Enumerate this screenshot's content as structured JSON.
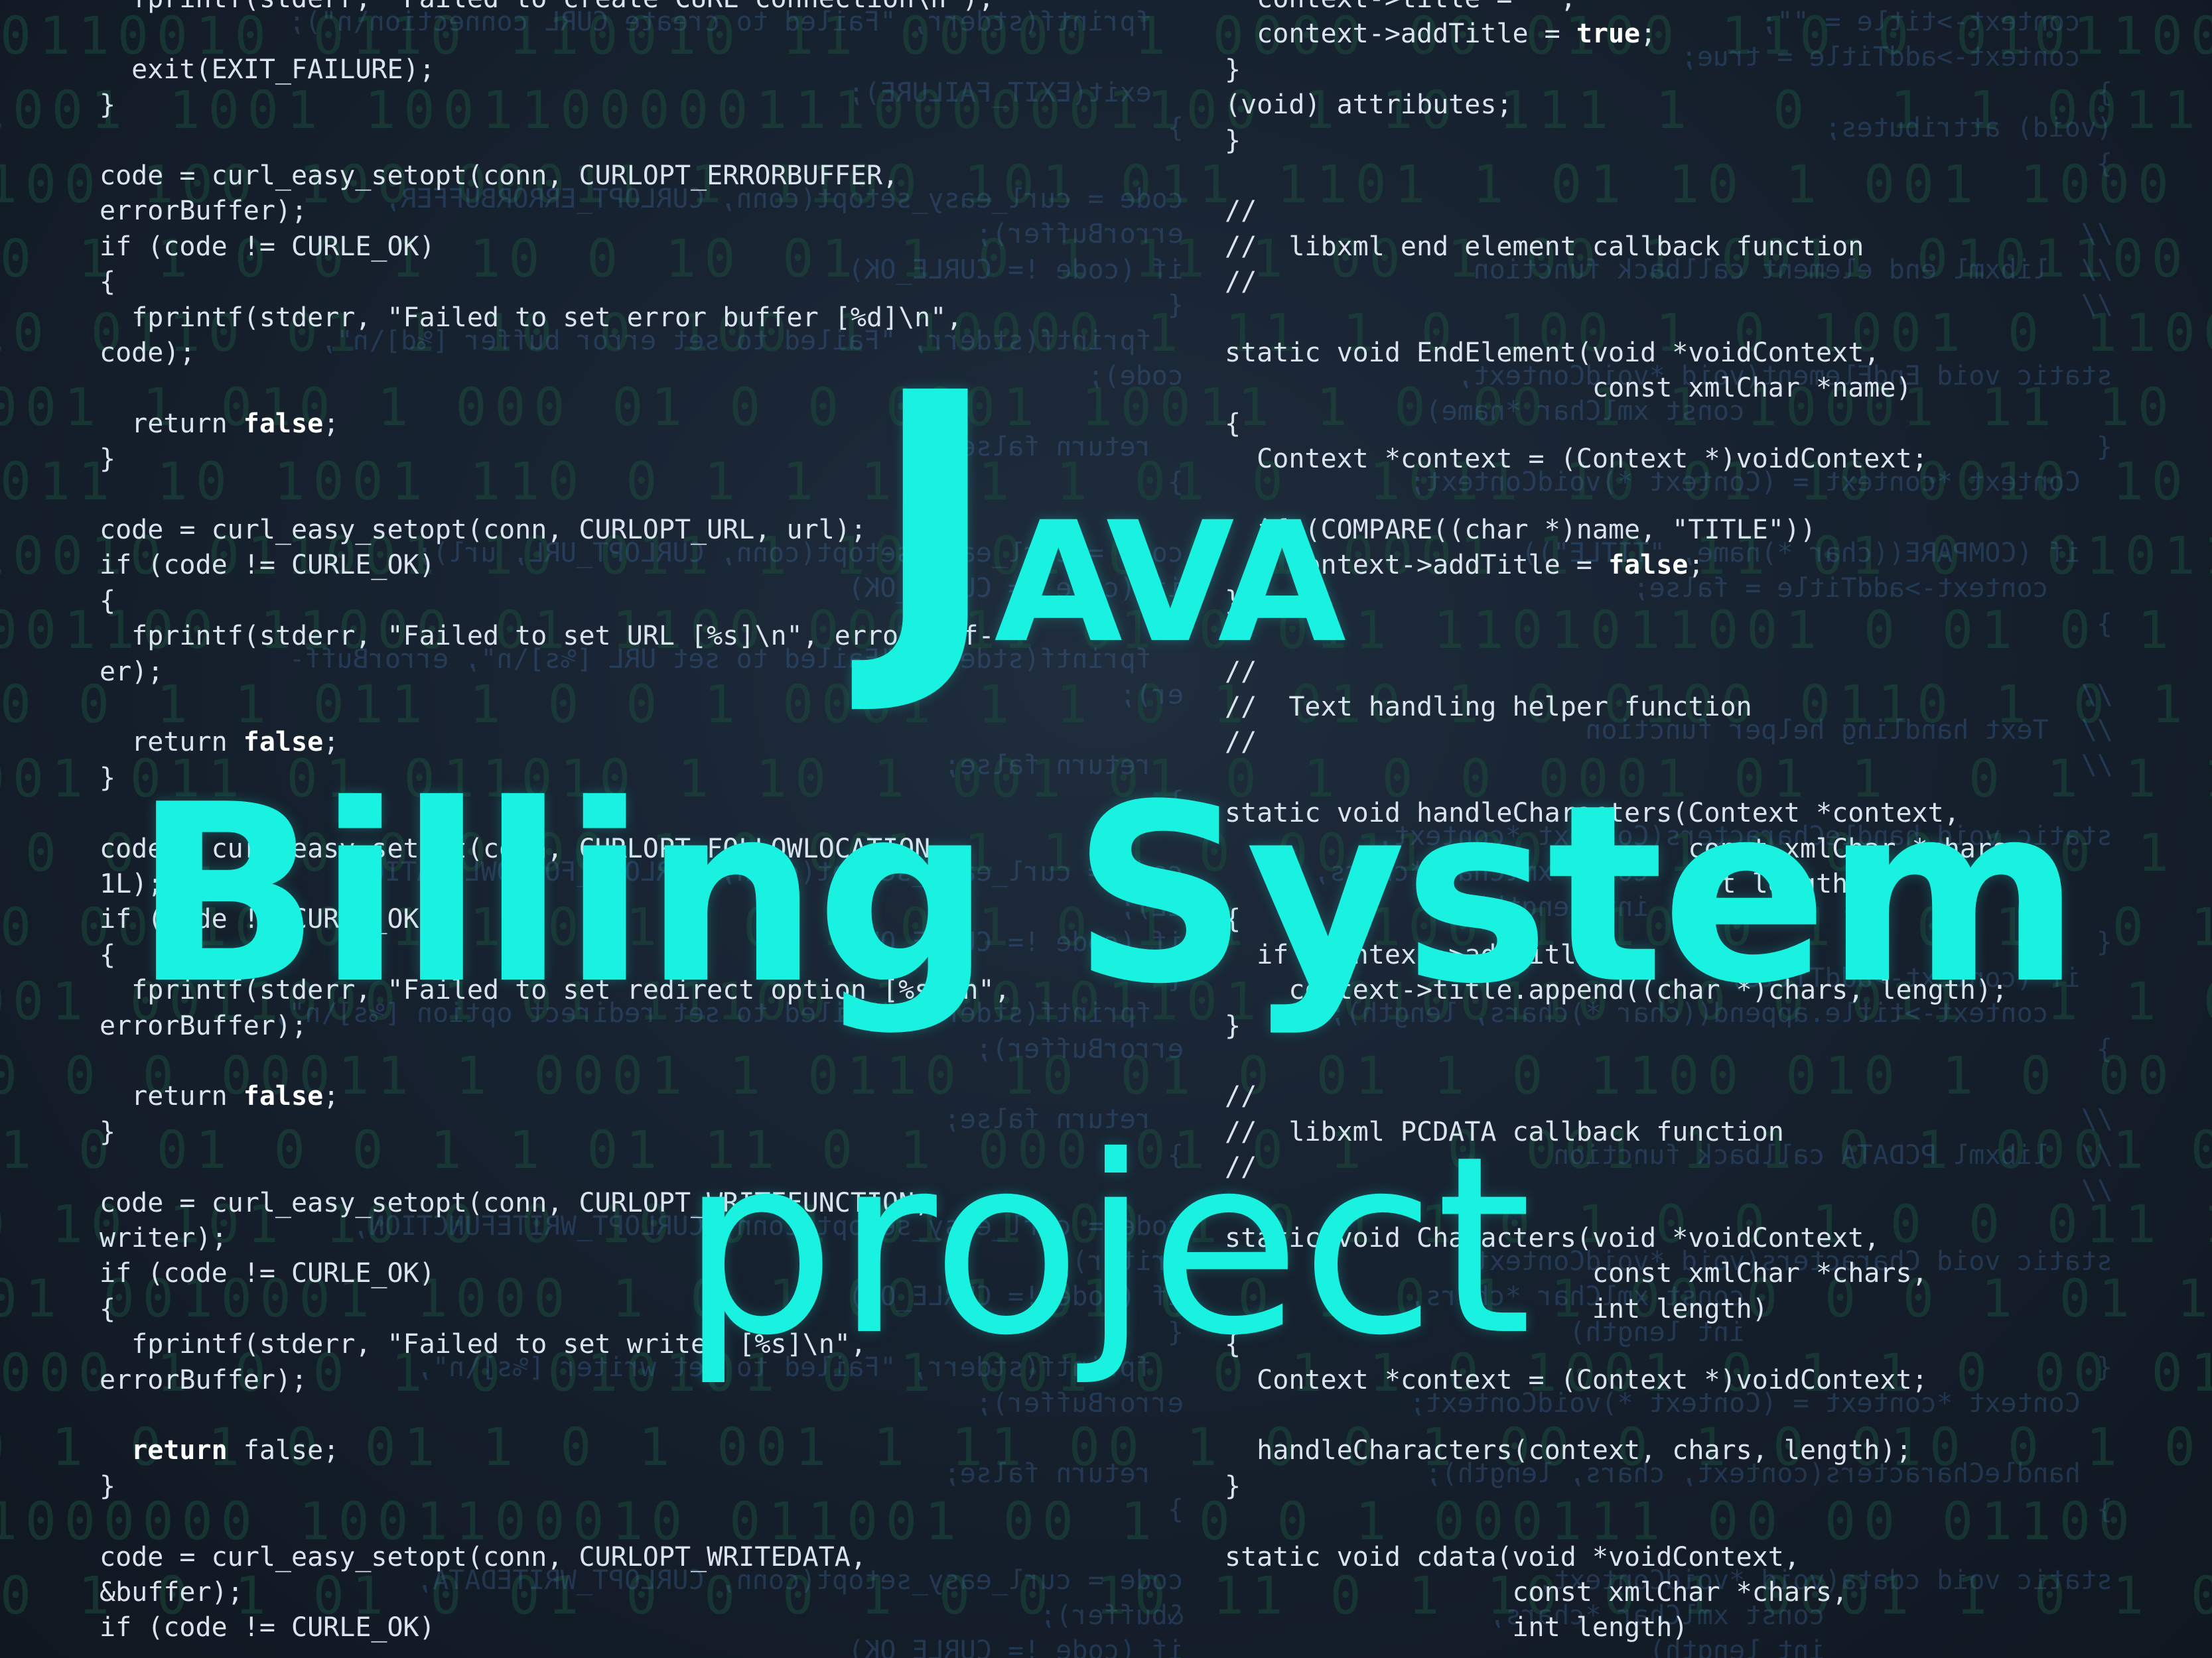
{
  "title": {
    "line1_big": "J",
    "line1_rest": "AVA",
    "line2": "Billing System",
    "line3": "project"
  },
  "binary_lines": [
    "0110010 0110 110010 11 00000 1 0000 00 0100 110 0 0101100010001",
    "1001 1001 10011000001110000001100 1 10 111 1  0  1 1 0011 0 1 1",
    "1100 100 100 00011 1 1100 101 011 1101 1 01 10 1 001 1000 0011",
    "0 1 1 0 0 1 10 0 10 01 1 0 1 11 1 00 1 00 1 0011 0101100  011 10",
    "10 0110 01 1 10 0 100 1 10000 1 11 1 0 100 1 0 1001 0 11001 0",
    "0001 1 010 1 000 01 0 0 0001 10011 1 0 00 1 1 10001 11 10 1 0",
    "011 10 1001 110 0 1 1 10 1 1 01 0  1011 10 01 10 0010 10 1101 0",
    "10010 011001 10 011 1 101 01 0 0 1 0001 1 0 11 01 0  0101100 1",
    "1001100 11000 01 1100 000011 01 0 011 1101011001 0 01 0 1 1",
    "0 0 1 1 011 1 0 0 1 0001 1 1 0 1 010 1 0 0100 0110 1 0 1 100 10",
    "001 011 01 011010 1 10 1 001 01 0 1 0 0 0001 01 1  0 1 1 101 0",
    "1 0 0 1 10 0 0 00 1 0 001 1 1 1 0 0011 00 1 1 0 0 0 1 0 1 1 100",
    "0 00 10 001 1 0 11 0 1 0 1 0 1 1 0 100 1 1010 11 0 10 0 1 0 00",
    "001 0011000 1 01 1110011100101101 00100110 00 0 011  1 1 00",
    "10 0 0 00011 1 0001 1 0110 10 01 0 01 1 0 1100 010 1 0 00 10 00",
    "1 0 01 0 0 1 1 01 11 0 1 000 01 0 1  0 001 1 1 0 1 0001 0 1 1 0",
    "0 10 101 10 0 0 10 0 1 01 1 00 1 0 1 1 0 1 0 0 1 0 0 011 1 1 011",
    "001 0010001 1000 1 0 1 00 1 01 0 0 1 0 1 1 00 0 0 0 1 01 1 1000",
    "000 1 0 0 1 0 010101 0 1 001 0 0 1 1 0 1001 0 1 1 0 00 0101 0 0",
    "0 1 0 1 0 01 1 0 1 001 1 11 00 1 0 0 1 00 0 1 0 010 0 1 0 1 10",
    "01000000 1001100010 011001 00 1 0 0 1 000111 00 00 01100",
    "0 1 0 1 01 0 01 0 0 0 1 0 0 10 11 0 1 10 0 1 0001 1 0 1 0 1 0 1"
  ],
  "code_left": [
    {
      "pre": "  fprintf(stderr, \"Failed to create CURL connection\\n\");",
      "kw": "",
      "post": ""
    },
    {
      "pre": "",
      "kw": "",
      "post": ""
    },
    {
      "pre": "  exit(EXIT_FAILURE);",
      "kw": "",
      "post": ""
    },
    {
      "pre": "}",
      "kw": "",
      "post": ""
    },
    {
      "pre": "",
      "kw": "",
      "post": ""
    },
    {
      "pre": "code = curl_easy_setopt(conn, CURLOPT_ERRORBUFFER,",
      "kw": "",
      "post": ""
    },
    {
      "pre": "errorBuffer);",
      "kw": "",
      "post": ""
    },
    {
      "pre": "if (code != CURLE_OK)",
      "kw": "",
      "post": ""
    },
    {
      "pre": "{",
      "kw": "",
      "post": ""
    },
    {
      "pre": "  fprintf(stderr, \"Failed to set error buffer [%d]\\n\",",
      "kw": "",
      "post": ""
    },
    {
      "pre": "code);",
      "kw": "",
      "post": ""
    },
    {
      "pre": "",
      "kw": "",
      "post": ""
    },
    {
      "pre": "  return ",
      "kw": "false",
      "post": ";"
    },
    {
      "pre": "}",
      "kw": "",
      "post": ""
    },
    {
      "pre": "",
      "kw": "",
      "post": ""
    },
    {
      "pre": "code = curl_easy_setopt(conn, CURLOPT_URL, url);",
      "kw": "",
      "post": ""
    },
    {
      "pre": "if (code != CURLE_OK)",
      "kw": "",
      "post": ""
    },
    {
      "pre": "{",
      "kw": "",
      "post": ""
    },
    {
      "pre": "  fprintf(stderr, \"Failed to set URL [%s]\\n\", errorBuff-",
      "kw": "",
      "post": ""
    },
    {
      "pre": "er);",
      "kw": "",
      "post": ""
    },
    {
      "pre": "",
      "kw": "",
      "post": ""
    },
    {
      "pre": "  return ",
      "kw": "false",
      "post": ";"
    },
    {
      "pre": "}",
      "kw": "",
      "post": ""
    },
    {
      "pre": "",
      "kw": "",
      "post": ""
    },
    {
      "pre": "code = curl_easy_setopt(conn, CURLOPT_FOLLOWLOCATION,",
      "kw": "",
      "post": ""
    },
    {
      "pre": "1L);",
      "kw": "",
      "post": ""
    },
    {
      "pre": "if (code != CURLE_OK)",
      "kw": "",
      "post": ""
    },
    {
      "pre": "{",
      "kw": "",
      "post": ""
    },
    {
      "pre": "  fprintf(stderr, \"Failed to set redirect option [%s]\\n\",",
      "kw": "",
      "post": ""
    },
    {
      "pre": "errorBuffer);",
      "kw": "",
      "post": ""
    },
    {
      "pre": "",
      "kw": "",
      "post": ""
    },
    {
      "pre": "  return ",
      "kw": "false",
      "post": ";"
    },
    {
      "pre": "}",
      "kw": "",
      "post": ""
    },
    {
      "pre": "",
      "kw": "",
      "post": ""
    },
    {
      "pre": "code = curl_easy_setopt(conn, CURLOPT_WRITEFUNCTION,",
      "kw": "",
      "post": ""
    },
    {
      "pre": "writer);",
      "kw": "",
      "post": ""
    },
    {
      "pre": "if (code != CURLE_OK)",
      "kw": "",
      "post": ""
    },
    {
      "pre": "{",
      "kw": "",
      "post": ""
    },
    {
      "pre": "  fprintf(stderr, \"Failed to set writer [%s]\\n\",",
      "kw": "",
      "post": ""
    },
    {
      "pre": "errorBuffer);",
      "kw": "",
      "post": ""
    },
    {
      "pre": "",
      "kw": "",
      "post": ""
    },
    {
      "pre": "  ",
      "kw": "return",
      "post": " false;"
    },
    {
      "pre": "}",
      "kw": "",
      "post": ""
    },
    {
      "pre": "",
      "kw": "",
      "post": ""
    },
    {
      "pre": "code = curl_easy_setopt(conn, CURLOPT_WRITEDATA,",
      "kw": "",
      "post": ""
    },
    {
      "pre": "&buffer);",
      "kw": "",
      "post": ""
    },
    {
      "pre": "if (code != CURLE_OK)",
      "kw": "",
      "post": ""
    }
  ],
  "code_right": [
    {
      "pre": "  context->title = \"\";",
      "kw": "",
      "post": ""
    },
    {
      "pre": "  context->addTitle = ",
      "kw": "true",
      "post": ";"
    },
    {
      "pre": "}",
      "kw": "",
      "post": ""
    },
    {
      "pre": "(void) attributes;",
      "kw": "",
      "post": ""
    },
    {
      "pre": "}",
      "kw": "",
      "post": ""
    },
    {
      "pre": "",
      "kw": "",
      "post": ""
    },
    {
      "pre": "//",
      "kw": "",
      "post": ""
    },
    {
      "pre": "//  libxml end element callback function",
      "kw": "",
      "post": ""
    },
    {
      "pre": "//",
      "kw": "",
      "post": ""
    },
    {
      "pre": "",
      "kw": "",
      "post": ""
    },
    {
      "pre": "static void EndElement(void *voidContext,",
      "kw": "",
      "post": ""
    },
    {
      "pre": "                       const xmlChar *name)",
      "kw": "",
      "post": ""
    },
    {
      "pre": "{",
      "kw": "",
      "post": ""
    },
    {
      "pre": "  Context *context = (Context *)voidContext;",
      "kw": "",
      "post": ""
    },
    {
      "pre": "",
      "kw": "",
      "post": ""
    },
    {
      "pre": "  if (COMPARE((char *)name, \"TITLE\"))",
      "kw": "",
      "post": ""
    },
    {
      "pre": "    context->addTitle = ",
      "kw": "false",
      "post": ";"
    },
    {
      "pre": "}",
      "kw": "",
      "post": ""
    },
    {
      "pre": "",
      "kw": "",
      "post": ""
    },
    {
      "pre": "//",
      "kw": "",
      "post": ""
    },
    {
      "pre": "//  Text handling helper function",
      "kw": "",
      "post": ""
    },
    {
      "pre": "//",
      "kw": "",
      "post": ""
    },
    {
      "pre": "",
      "kw": "",
      "post": ""
    },
    {
      "pre": "static void handleCharacters(Context *context,",
      "kw": "",
      "post": ""
    },
    {
      "pre": "                             const xmlChar *chars,",
      "kw": "",
      "post": ""
    },
    {
      "pre": "                             int length)",
      "kw": "",
      "post": ""
    },
    {
      "pre": "{",
      "kw": "",
      "post": ""
    },
    {
      "pre": "  if (context->addTitle)",
      "kw": "",
      "post": ""
    },
    {
      "pre": "    context->title.append((char *)chars, length);",
      "kw": "",
      "post": ""
    },
    {
      "pre": "}",
      "kw": "",
      "post": ""
    },
    {
      "pre": "",
      "kw": "",
      "post": ""
    },
    {
      "pre": "//",
      "kw": "",
      "post": ""
    },
    {
      "pre": "//  libxml PCDATA callback function",
      "kw": "",
      "post": ""
    },
    {
      "pre": "//",
      "kw": "",
      "post": ""
    },
    {
      "pre": "",
      "kw": "",
      "post": ""
    },
    {
      "pre": "static void Characters(void *voidContext,",
      "kw": "",
      "post": ""
    },
    {
      "pre": "                       const xmlChar *chars,",
      "kw": "",
      "post": ""
    },
    {
      "pre": "                       int length)",
      "kw": "",
      "post": ""
    },
    {
      "pre": "{",
      "kw": "",
      "post": ""
    },
    {
      "pre": "  Context *context = (Context *)voidContext;",
      "kw": "",
      "post": ""
    },
    {
      "pre": "",
      "kw": "",
      "post": ""
    },
    {
      "pre": "  handleCharacters(context, chars, length);",
      "kw": "",
      "post": ""
    },
    {
      "pre": "}",
      "kw": "",
      "post": ""
    },
    {
      "pre": "",
      "kw": "",
      "post": ""
    },
    {
      "pre": "static void cdata(void *voidContext,",
      "kw": "",
      "post": ""
    },
    {
      "pre": "                  const xmlChar *chars,",
      "kw": "",
      "post": ""
    },
    {
      "pre": "                  int length)",
      "kw": "",
      "post": ""
    }
  ],
  "colors": {
    "title": "#19f2e0",
    "code_text": "#dbe4ee",
    "binary": "#1b4a3b",
    "background": "#172230"
  }
}
